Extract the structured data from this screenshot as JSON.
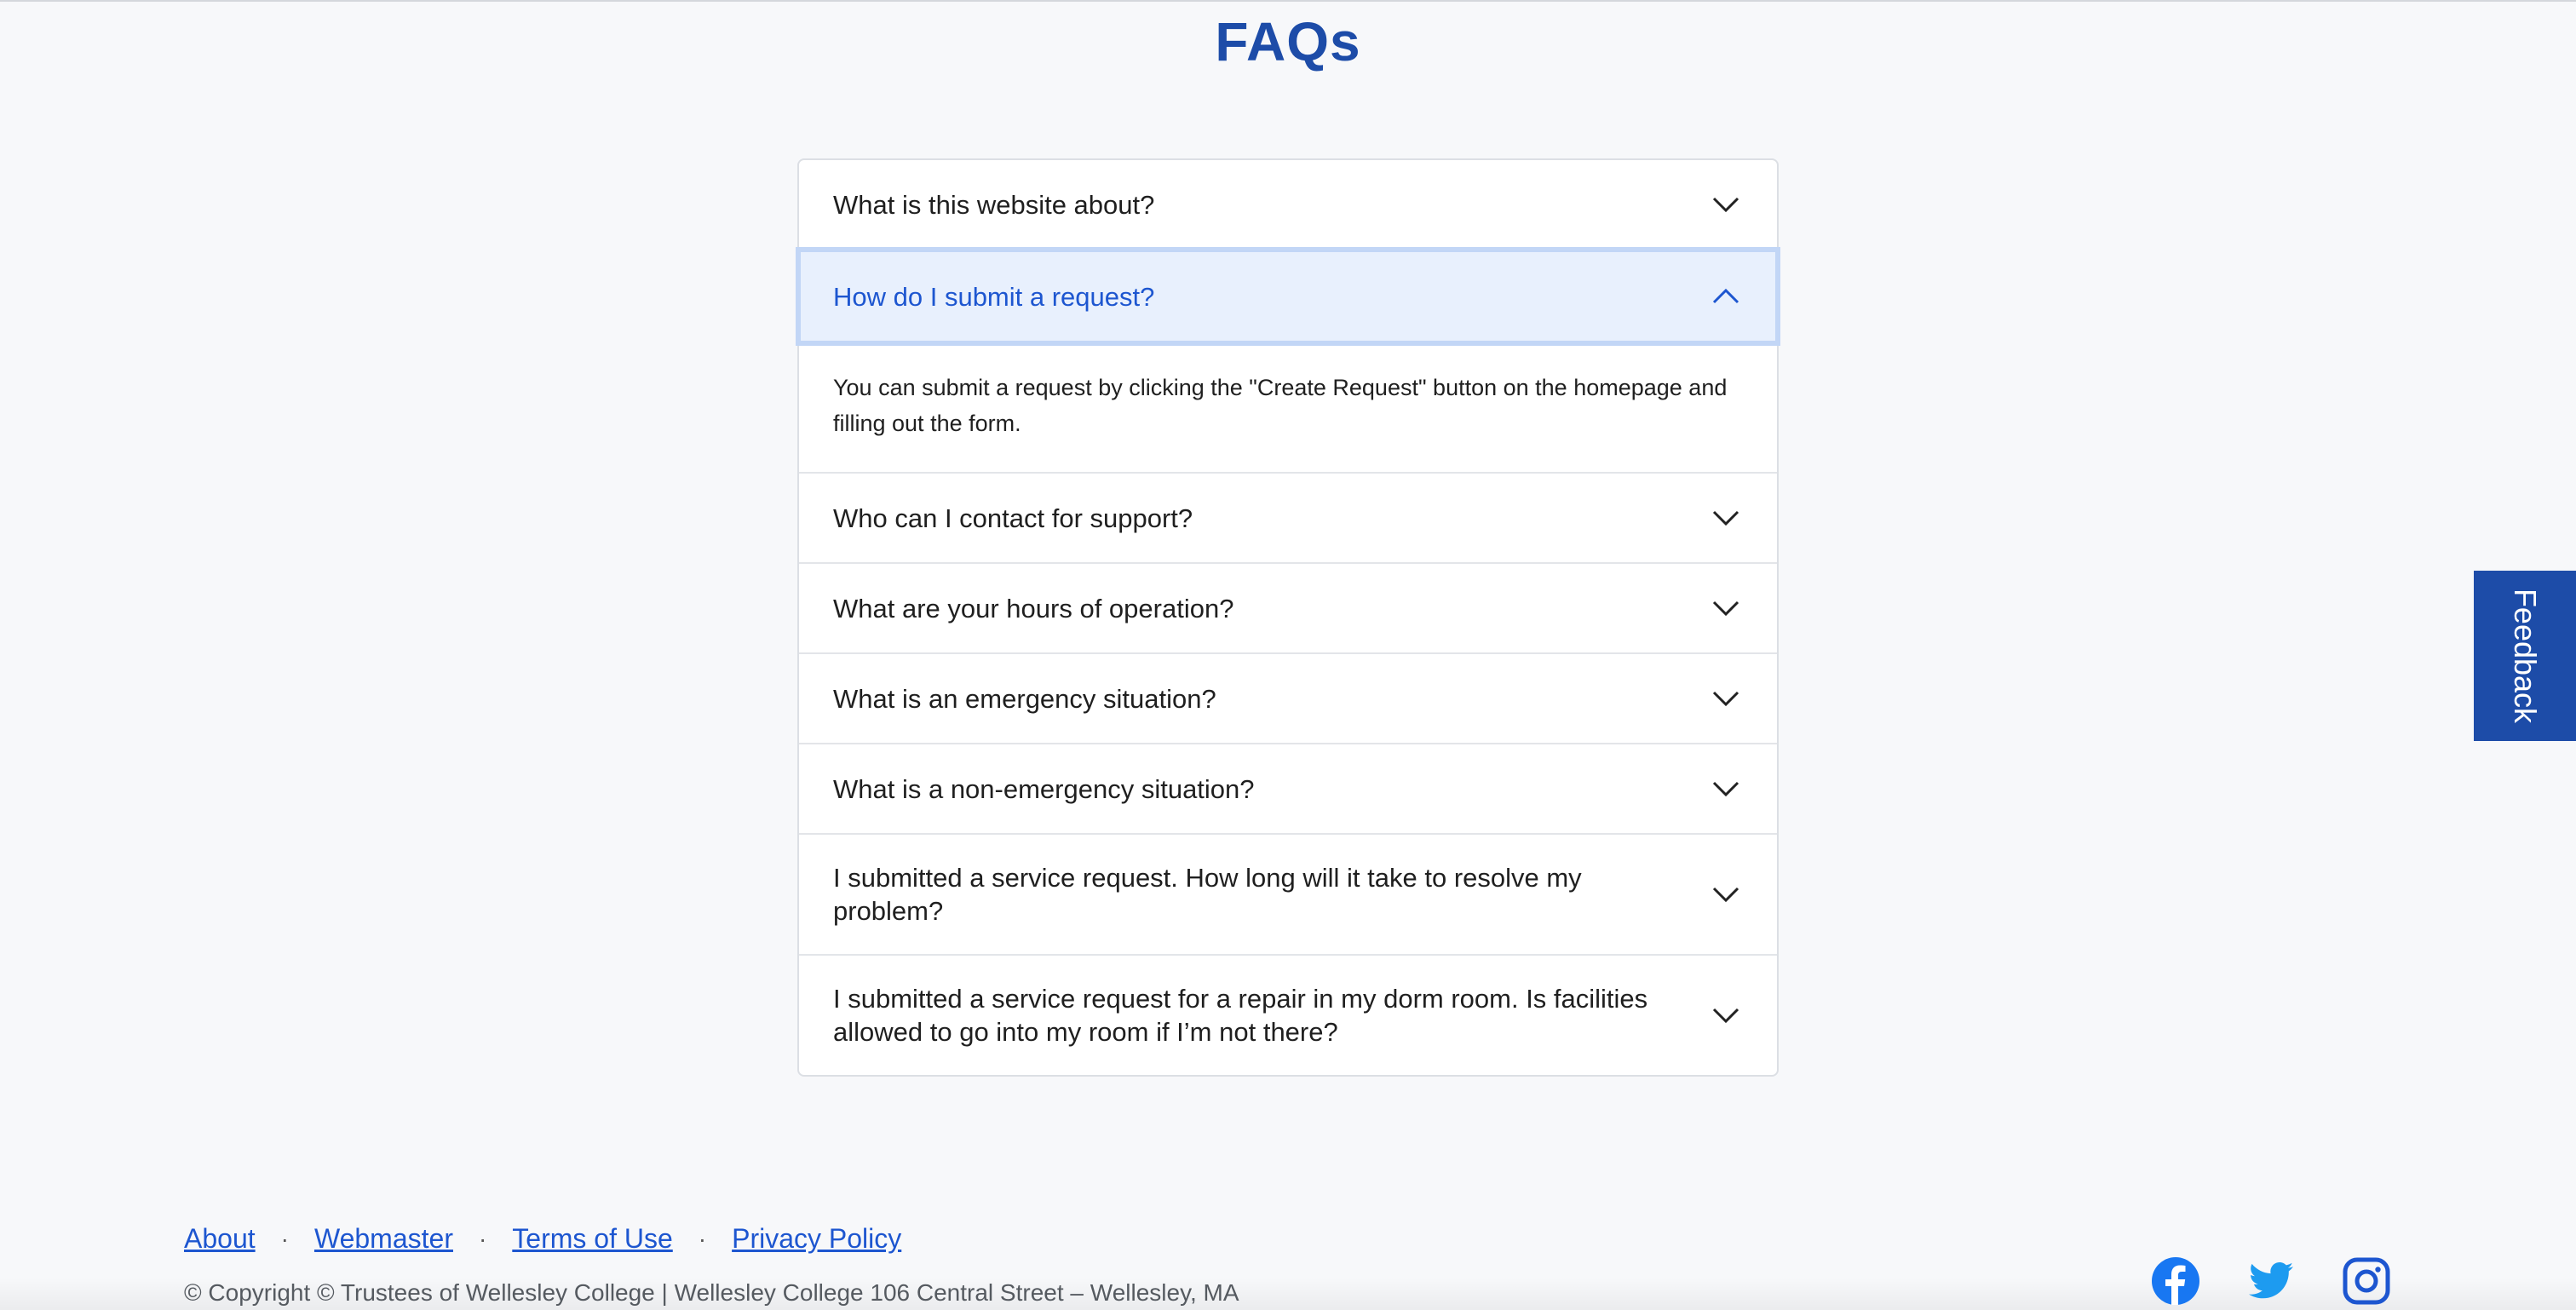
{
  "page": {
    "title": "FAQs"
  },
  "faq": {
    "items": [
      {
        "question": "What is this website about?",
        "expanded": false
      },
      {
        "question": "How do I submit a request?",
        "expanded": true,
        "answer": "You can submit a request by clicking the \"Create Request\" button on the homepage and filling out the form."
      },
      {
        "question": "Who can I contact for support?",
        "expanded": false
      },
      {
        "question": "What are your hours of operation?",
        "expanded": false
      },
      {
        "question": "What is an emergency situation?",
        "expanded": false
      },
      {
        "question": "What is a non-emergency situation?",
        "expanded": false
      },
      {
        "question": "I submitted a service request. How long will it take to resolve my problem?",
        "expanded": false
      },
      {
        "question": "I submitted a service request for a repair in my dorm room. Is facilities allowed to go into my room if I’m not there?",
        "expanded": false
      }
    ]
  },
  "feedback": {
    "label": "Feedback"
  },
  "footer": {
    "links": {
      "about": "About",
      "webmaster": "Webmaster",
      "terms": "Terms of Use",
      "privacy": "Privacy Policy"
    },
    "separator": "·",
    "copyright": "© Copyright © Trustees of Wellesley College | Wellesley College 106 Central Street – Wellesley, MA",
    "social_icons": [
      "facebook-icon",
      "twitter-icon",
      "instagram-icon"
    ]
  },
  "colors": {
    "accent": "#1d4ca8",
    "link": "#1d56d0",
    "expanded_bg": "#e8f0fd",
    "page_bg": "#f7f8fa"
  }
}
